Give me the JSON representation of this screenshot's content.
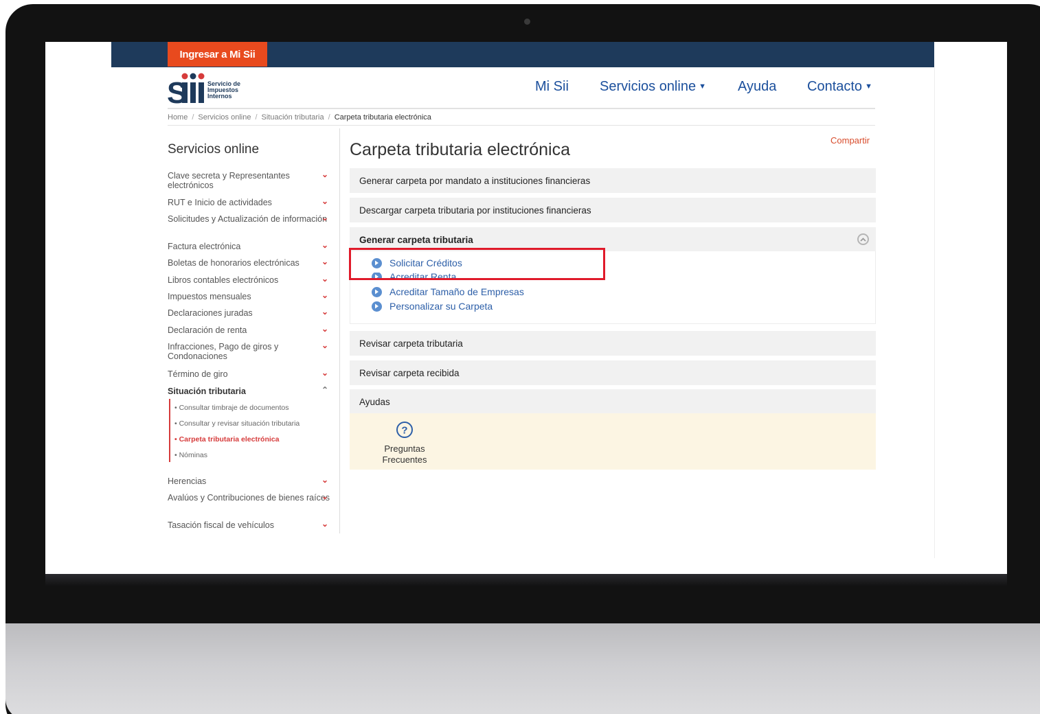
{
  "topbar": {
    "login_label": "Ingresar a Mi Sii"
  },
  "logo": {
    "line1": "Servicio de",
    "line2": "Impuestos",
    "line3": "Internos"
  },
  "nav": {
    "mi_sii": "Mi Sii",
    "servicios_online": "Servicios online",
    "ayuda": "Ayuda",
    "contacto": "Contacto"
  },
  "breadcrumb": {
    "home": "Home",
    "servicios": "Servicios online",
    "situacion": "Situación tributaria",
    "current": "Carpeta tributaria electrónica"
  },
  "sidebar": {
    "title": "Servicios online",
    "items": [
      {
        "label": "Clave secreta y Representantes electrónicos"
      },
      {
        "label": "RUT e Inicio de actividades"
      },
      {
        "label": "Solicitudes y Actualización de información"
      },
      {
        "label": "Factura electrónica"
      },
      {
        "label": "Boletas de honorarios electrónicas"
      },
      {
        "label": "Libros contables electrónicos"
      },
      {
        "label": "Impuestos mensuales"
      },
      {
        "label": "Declaraciones juradas"
      },
      {
        "label": "Declaración de renta"
      },
      {
        "label": "Infracciones, Pago de giros y Condonaciones"
      },
      {
        "label": "Término de giro"
      },
      {
        "label": "Situación tributaria"
      },
      {
        "label": "Herencias"
      },
      {
        "label": "Avalúos y Contribuciones de bienes raíces"
      },
      {
        "label": "Tasación fiscal de vehículos"
      }
    ],
    "subitems": [
      {
        "label": "Consultar timbraje de documentos"
      },
      {
        "label": "Consultar y revisar situación tributaria"
      },
      {
        "label": "Carpeta tributaria electrónica"
      },
      {
        "label": "Nóminas"
      }
    ]
  },
  "main": {
    "title": "Carpeta tributaria electrónica",
    "share": "Compartir",
    "sections": [
      {
        "label": "Generar carpeta por mandato a instituciones financieras"
      },
      {
        "label": "Descargar carpeta tributaria por instituciones financieras"
      },
      {
        "label": "Generar carpeta tributaria"
      },
      {
        "label": "Revisar carpeta tributaria"
      },
      {
        "label": "Revisar carpeta recibida"
      },
      {
        "label": "Ayudas"
      }
    ],
    "links": [
      {
        "label": "Solicitar Créditos"
      },
      {
        "label": "Acreditar Renta"
      },
      {
        "label": "Acreditar Tamaño de Empresas"
      },
      {
        "label": "Personalizar su Carpeta"
      }
    ],
    "faq": {
      "line1": "Preguntas",
      "line2": "Frecuentes"
    }
  },
  "colors": {
    "topbar": "#1e3a5b",
    "login_button": "#e84a1e",
    "nav_link": "#1b4f9c",
    "accent_red": "#d63b3b",
    "highlight_box": "#e01a2a",
    "ayuda_bg": "#fcf5e3"
  }
}
